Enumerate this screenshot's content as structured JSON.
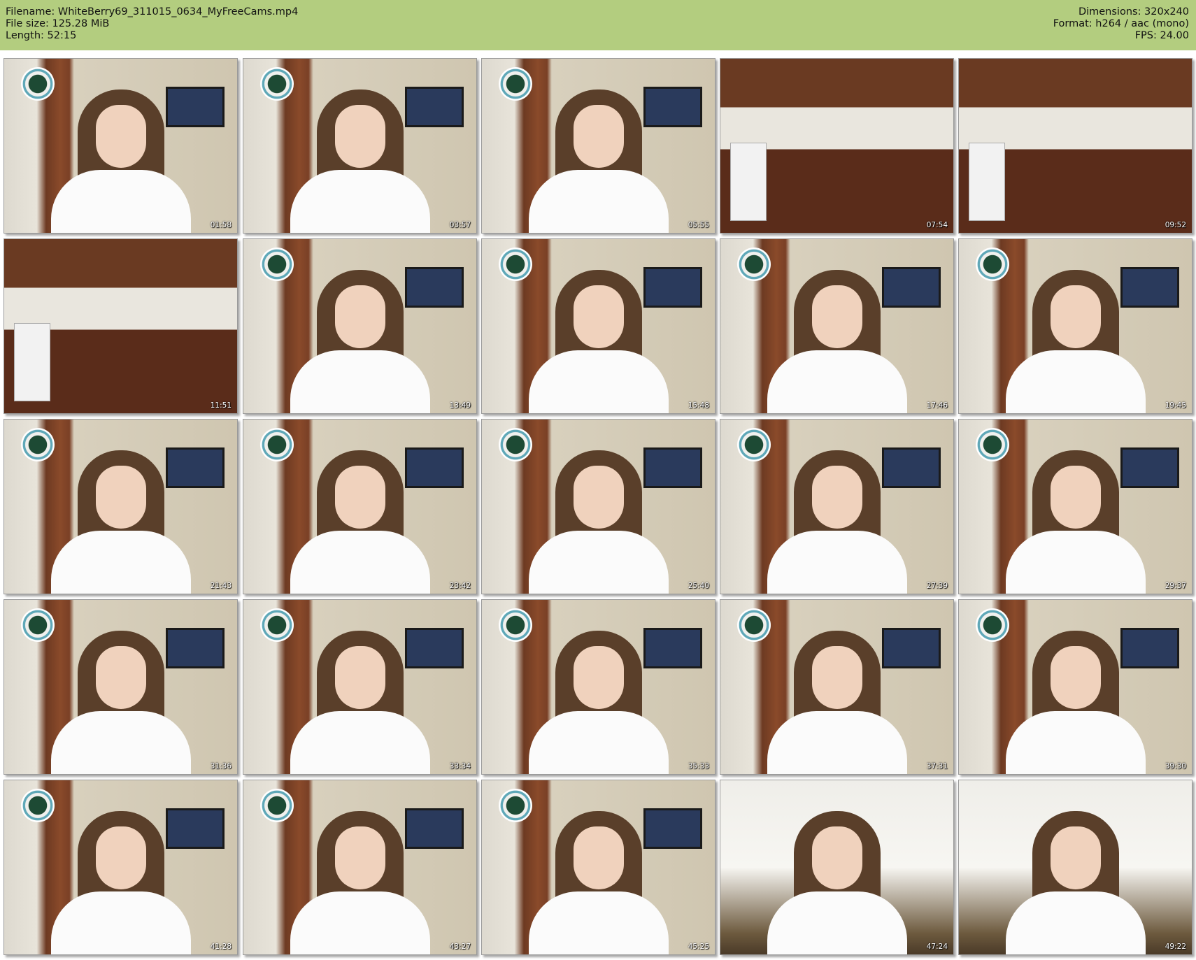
{
  "header": {
    "filename": "Filename: WhiteBerry69_311015_0634_MyFreeCams.mp4",
    "filesize": "File size: 125.28 MiB",
    "length": "Length: 52:15",
    "dimensions": "Dimensions: 320x240",
    "format": "Format: h264 / aac (mono)",
    "fps": "FPS: 24.00"
  },
  "colors": {
    "header_bg": "#b3cd7f",
    "page_bg": "#ffffff"
  },
  "thumbnails": [
    {
      "time": "01:58",
      "scene": "room"
    },
    {
      "time": "03:57",
      "scene": "room"
    },
    {
      "time": "05:55",
      "scene": "room"
    },
    {
      "time": "07:54",
      "scene": "kitchen"
    },
    {
      "time": "09:52",
      "scene": "kitchen"
    },
    {
      "time": "11:51",
      "scene": "kitchen"
    },
    {
      "time": "13:49",
      "scene": "room"
    },
    {
      "time": "15:48",
      "scene": "room"
    },
    {
      "time": "17:46",
      "scene": "room"
    },
    {
      "time": "19:45",
      "scene": "room"
    },
    {
      "time": "21:43",
      "scene": "room"
    },
    {
      "time": "23:42",
      "scene": "room"
    },
    {
      "time": "25:40",
      "scene": "room"
    },
    {
      "time": "27:39",
      "scene": "room"
    },
    {
      "time": "29:37",
      "scene": "room"
    },
    {
      "time": "31:36",
      "scene": "room"
    },
    {
      "time": "33:34",
      "scene": "room"
    },
    {
      "time": "35:33",
      "scene": "room"
    },
    {
      "time": "37:31",
      "scene": "room"
    },
    {
      "time": "39:30",
      "scene": "room"
    },
    {
      "time": "41:28",
      "scene": "room"
    },
    {
      "time": "43:27",
      "scene": "room"
    },
    {
      "time": "45:25",
      "scene": "room"
    },
    {
      "time": "47:24",
      "scene": "bright"
    },
    {
      "time": "49:22",
      "scene": "bright"
    }
  ]
}
